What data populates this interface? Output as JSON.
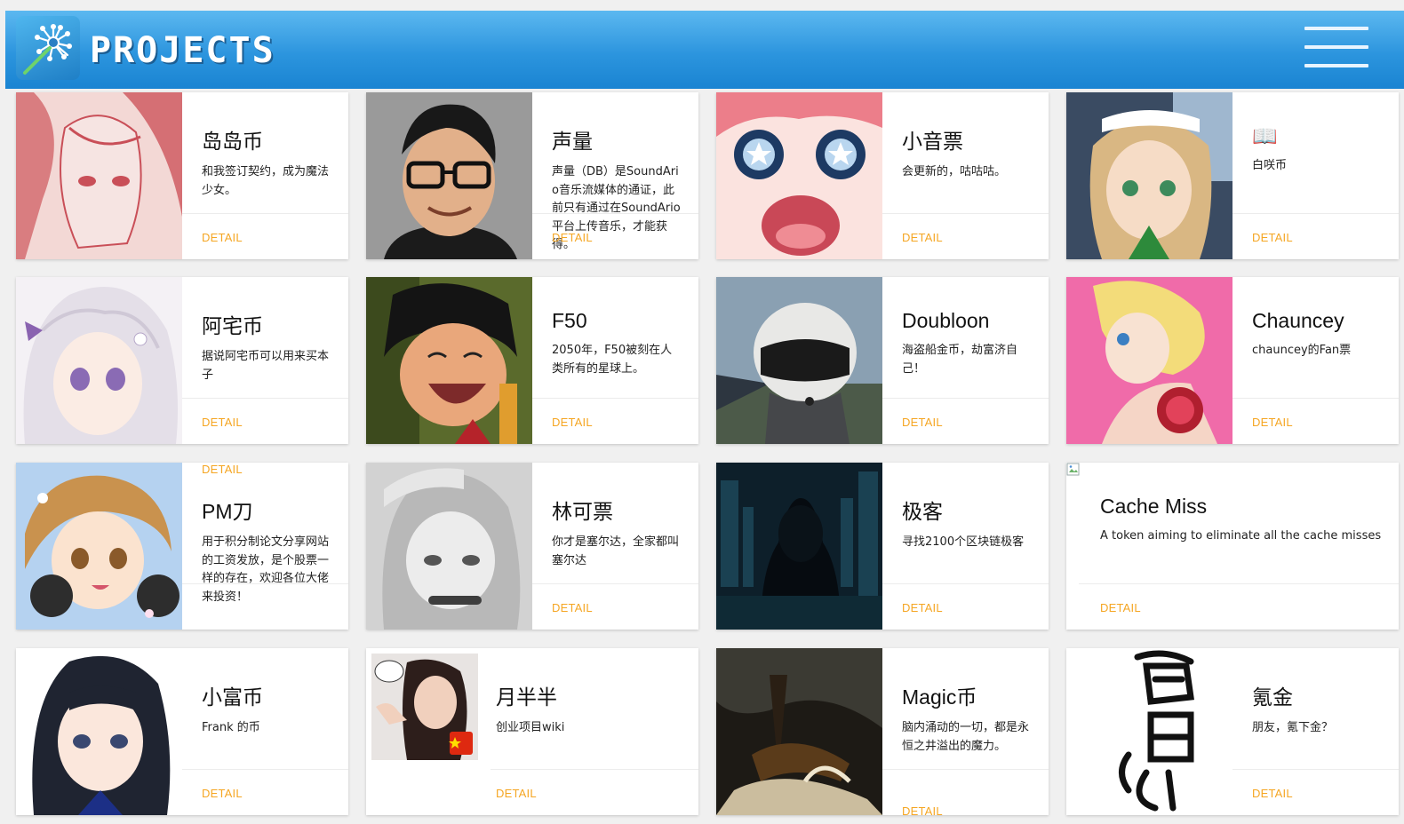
{
  "header": {
    "title": "PROJECTS"
  },
  "cards": [
    {
      "title": "岛岛币",
      "desc": "和我签订契约，成为魔法少女。",
      "detail": "DETAIL"
    },
    {
      "title": "声量",
      "desc": "声量（DB）是SoundArio音乐流媒体的通证，此前只有通过在SoundArio平台上传音乐，才能获得。",
      "detail": "DETAIL"
    },
    {
      "title": "小音票",
      "desc": "会更新的，咕咕咕。",
      "detail": "DETAIL"
    },
    {
      "title": "📖",
      "desc": "白咲币",
      "detail": "DETAIL"
    },
    {
      "title": "阿宅币",
      "desc": "据说阿宅币可以用来买本子",
      "detail": "DETAIL"
    },
    {
      "title": "F50",
      "desc": "2050年，F50被刻在人类所有的星球上。",
      "detail": "DETAIL"
    },
    {
      "title": "Doubloon",
      "desc": "海盗船金币，劫富济自己！",
      "detail": "DETAIL"
    },
    {
      "title": "Chauncey",
      "desc": "chauncey的Fan票",
      "detail": "DETAIL"
    },
    {
      "title": "PM刀",
      "desc": "用于积分制论文分享网站的工资发放，是个股票一样的存在，欢迎各位大佬来投资！",
      "detail": "DETAIL"
    },
    {
      "title": "林可票",
      "desc": "你才是塞尔达，全家都叫塞尔达",
      "detail": "DETAIL"
    },
    {
      "title": "极客",
      "desc": "寻找2100个区块链极客",
      "detail": "DETAIL"
    },
    {
      "title": "Cache Miss",
      "desc": "A token aiming to eliminate all the cache misses",
      "detail": "DETAIL"
    },
    {
      "title": "小富币",
      "desc": "Frank 的币",
      "detail": "DETAIL"
    },
    {
      "title": "月半半",
      "desc": "创业项目wiki",
      "detail": "DETAIL"
    },
    {
      "title": "Magic币",
      "desc": "脑内涌动的一切，都是永恒之井溢出的魔力。",
      "detail": "DETAIL"
    },
    {
      "title": "氪金",
      "desc": "朋友，氪下金？",
      "detail": "DETAIL"
    }
  ],
  "colors": {
    "accent": "#f5a623",
    "header": "#2c95de"
  }
}
